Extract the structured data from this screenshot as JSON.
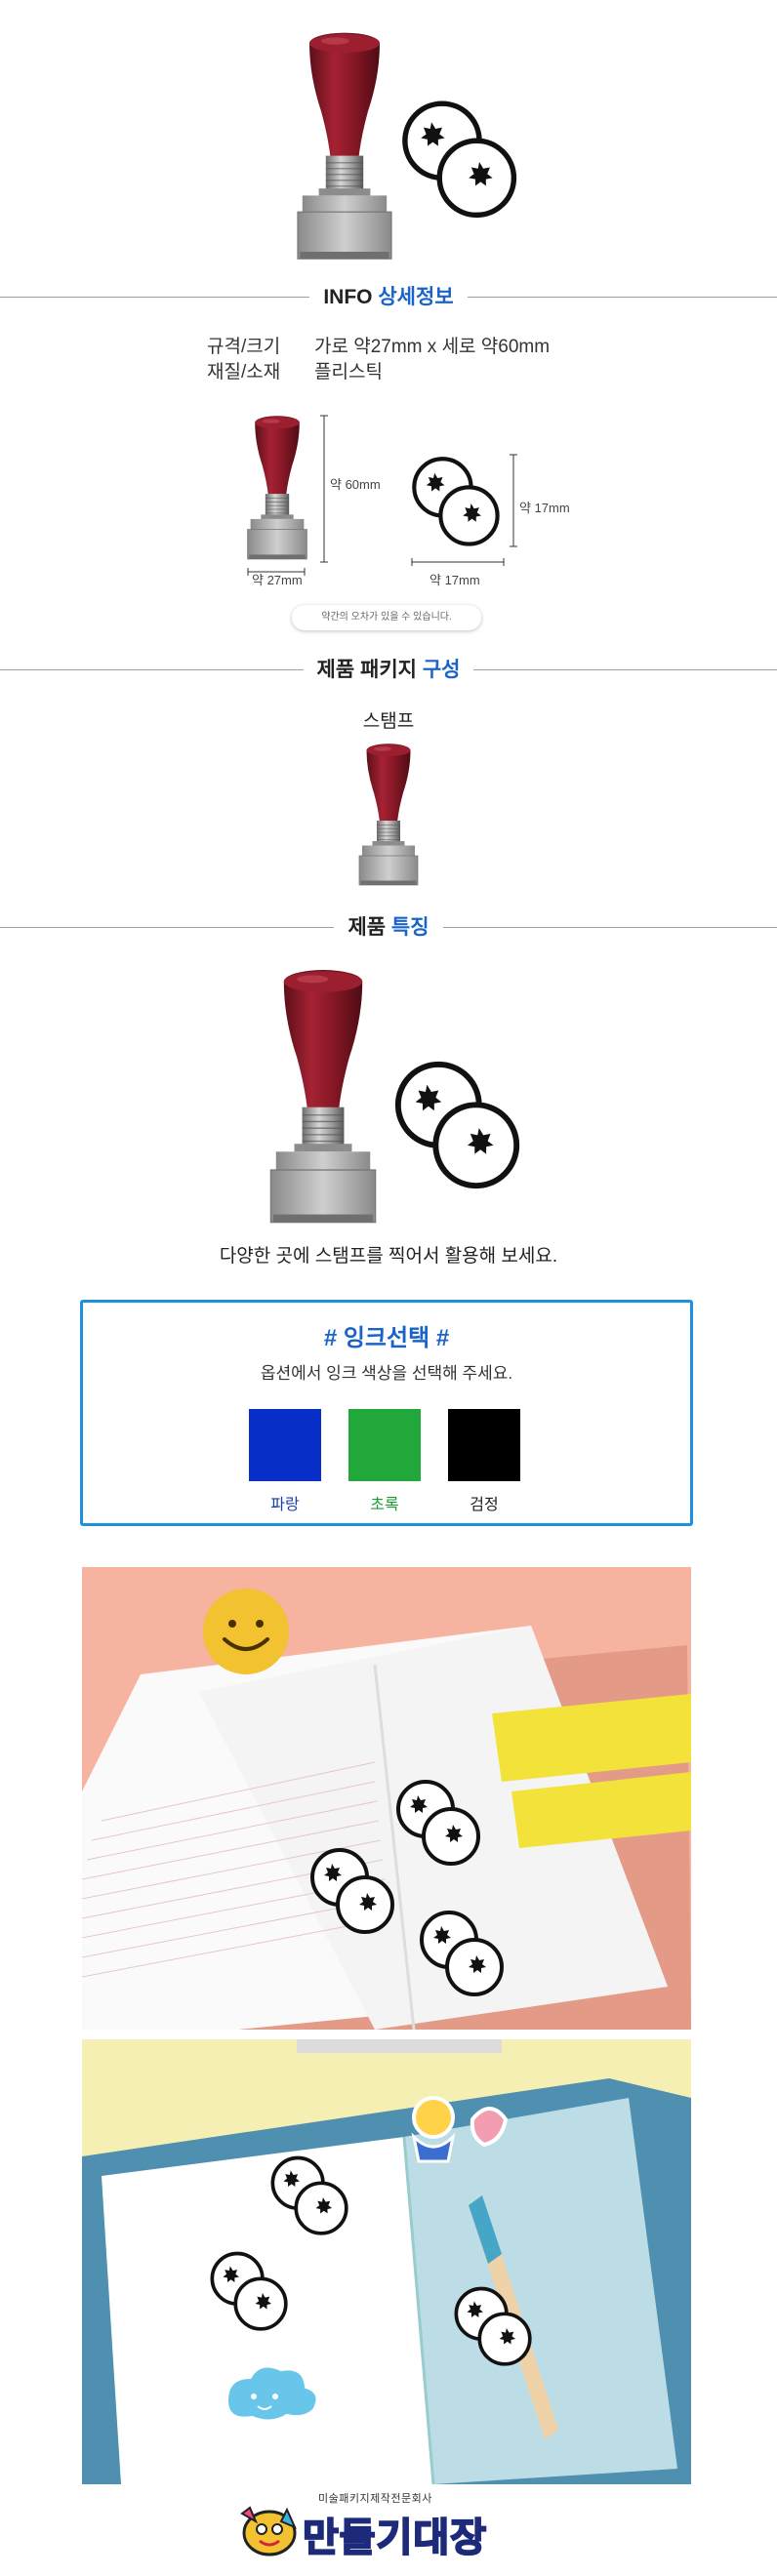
{
  "info": {
    "title_prefix": "INFO",
    "title_accent": "상세정보",
    "rows": [
      {
        "label": "규격/크기",
        "value": "가로 약27mm x 세로 약60mm"
      },
      {
        "label": "재질/소재",
        "value": "플리스틱"
      }
    ],
    "dims": {
      "stamp_height": "약 60mm",
      "stamp_width": "약 27mm",
      "print_height": "약 17mm",
      "print_width": "약 17mm"
    },
    "note": "약간의 오차가 있을 수 있습니다."
  },
  "package": {
    "title_prefix": "제품 패키지",
    "title_accent": "구성",
    "item_label": "스탬프"
  },
  "features": {
    "title_prefix": "제품",
    "title_accent": "특징",
    "caption": "다양한 곳에 스탬프를 찍어서 활용해 보세요."
  },
  "ink": {
    "title": "# 잉크선택 #",
    "subtitle": "옵션에서 잉크 색상을 선택해 주세요.",
    "options": [
      {
        "label": "파랑",
        "color": "#0a2fc9",
        "label_color": "#1a3fa8"
      },
      {
        "label": "초록",
        "color": "#22a83a",
        "label_color": "#1e9a33"
      },
      {
        "label": "검정",
        "color": "#000000",
        "label_color": "#222222"
      }
    ]
  },
  "brand": {
    "tagline": "미술패키지제작전문회사",
    "logo_text": "만들기대장"
  },
  "colors": {
    "accent": "#1a63c9",
    "box_border": "#1f8fe0",
    "stamp_handle": "#8e1c2a",
    "stamp_base": "#a9a9a9"
  }
}
